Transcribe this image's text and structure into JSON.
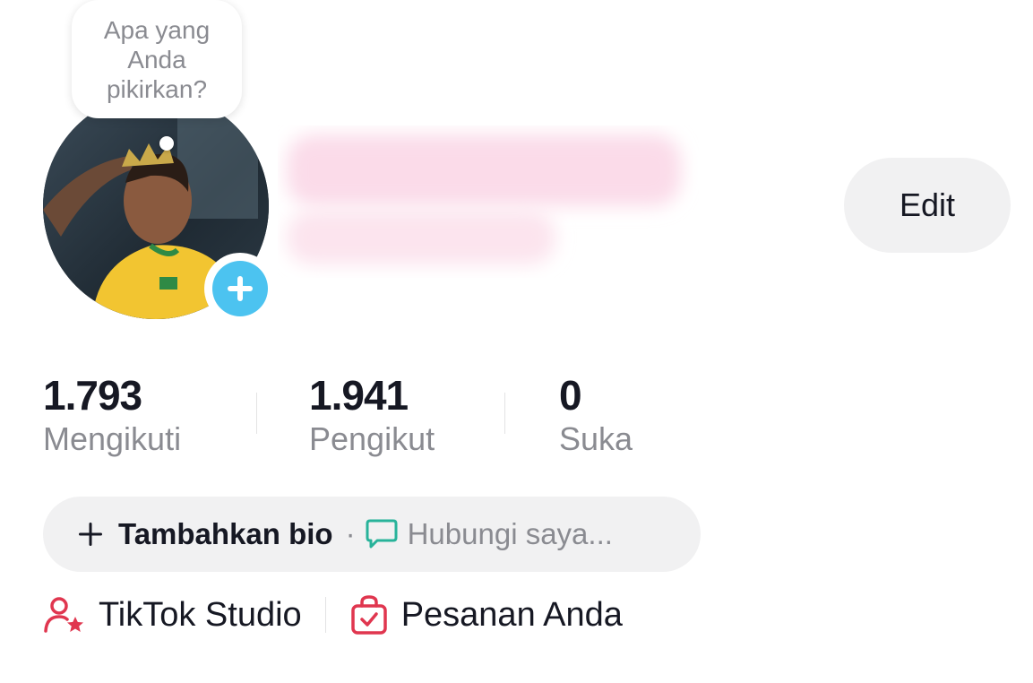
{
  "bubble": {
    "prompt": "Apa yang Anda pikirkan?"
  },
  "profile": {
    "edit_label": "Edit"
  },
  "stats": [
    {
      "value": "1.793",
      "label": "Mengikuti"
    },
    {
      "value": "1.941",
      "label": "Pengikut"
    },
    {
      "value": "0",
      "label": "Suka"
    }
  ],
  "bio": {
    "add_label": "Tambahkan bio",
    "separator": "·",
    "contact_label": "Hubungi saya..."
  },
  "links": {
    "studio_label": "TikTok Studio",
    "orders_label": "Pesanan Anda"
  },
  "icons": {
    "add_story": "plus-icon",
    "bio_add": "plus-icon",
    "contact": "chat-bubble-icon",
    "studio": "user-star-icon",
    "orders": "shopping-bag-check-icon"
  },
  "colors": {
    "accent_blue": "#4cc3f0",
    "accent_red": "#e0364f",
    "contact_green": "#28b39a",
    "pill_bg": "#f1f1f2",
    "muted_text": "#8a8b91"
  }
}
